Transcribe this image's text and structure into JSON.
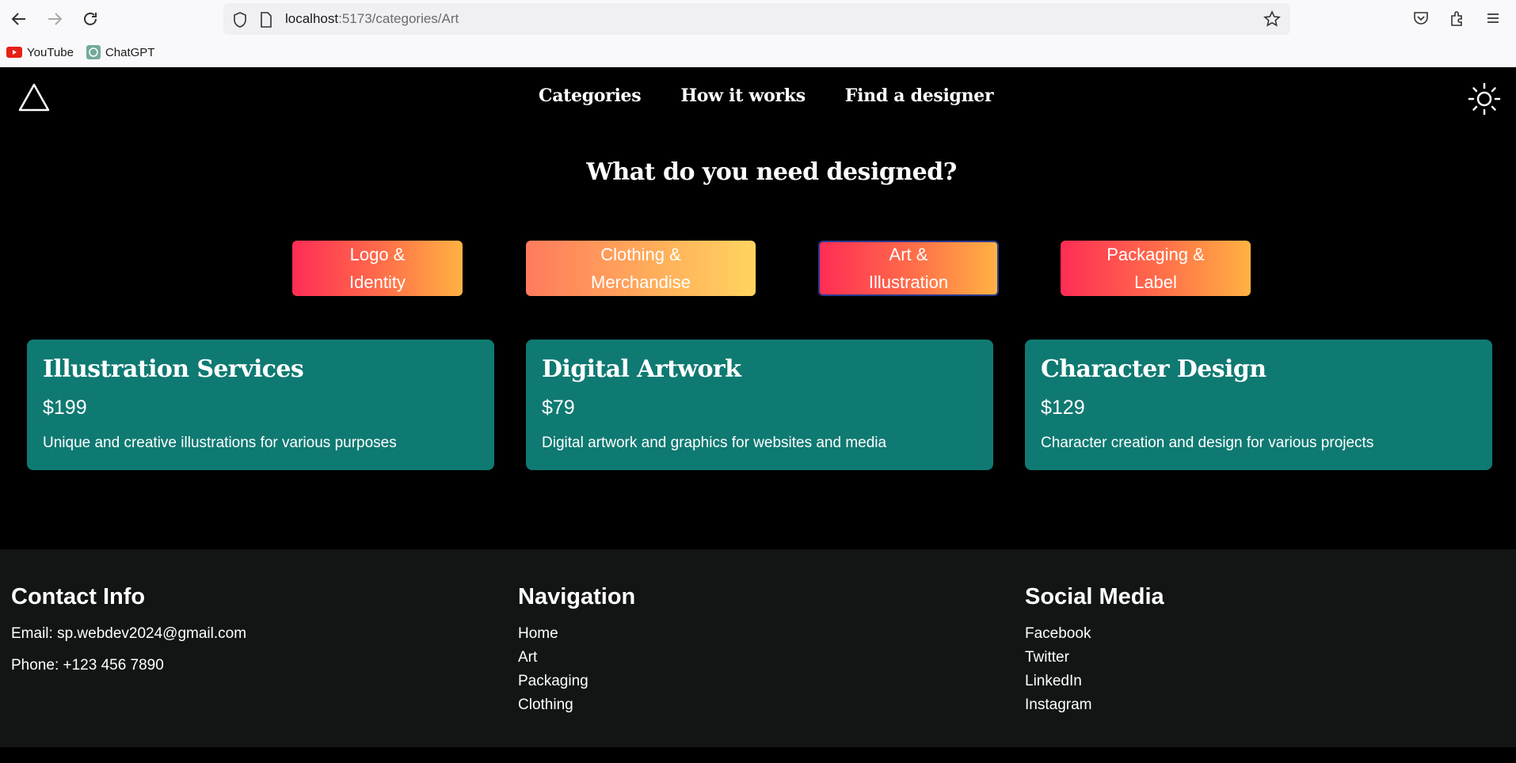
{
  "browser": {
    "url_host": "localhost",
    "url_path": ":5173/categories/Art",
    "bookmarks": [
      {
        "label": "YouTube",
        "icon": "youtube-icon"
      },
      {
        "label": "ChatGPT",
        "icon": "chatgpt-icon"
      }
    ]
  },
  "header": {
    "nav": [
      "Categories",
      "How it works",
      "Find a designer"
    ]
  },
  "hero": {
    "title": "What do you need designed?"
  },
  "categories": [
    {
      "line1": "Logo &",
      "line2": "Identity",
      "active": false
    },
    {
      "line1": "Clothing &",
      "line2": "Merchandise",
      "active": false
    },
    {
      "line1": "Art &",
      "line2": "Illustration",
      "active": true
    },
    {
      "line1": "Packaging &",
      "line2": "Label",
      "active": false
    }
  ],
  "services": [
    {
      "title": "Illustration Services",
      "price": "$199",
      "description": "Unique and creative illustrations for various purposes"
    },
    {
      "title": "Digital Artwork",
      "price": "$79",
      "description": "Digital artwork and graphics for websites and media"
    },
    {
      "title": "Character Design",
      "price": "$129",
      "description": "Character creation and design for various projects"
    }
  ],
  "footer": {
    "contact": {
      "heading": "Contact Info",
      "email": "Email: sp.webdev2024@gmail.com",
      "phone": "Phone: +123 456 7890"
    },
    "navigation": {
      "heading": "Navigation",
      "links": [
        "Home",
        "Art",
        "Packaging",
        "Clothing"
      ]
    },
    "social": {
      "heading": "Social Media",
      "links": [
        "Facebook",
        "Twitter",
        "LinkedIn",
        "Instagram"
      ]
    }
  },
  "colors": {
    "page_bg": "#000000",
    "card_bg": "#0f7a72",
    "footer_bg": "#131515",
    "active_border": "#2b3a8f"
  }
}
